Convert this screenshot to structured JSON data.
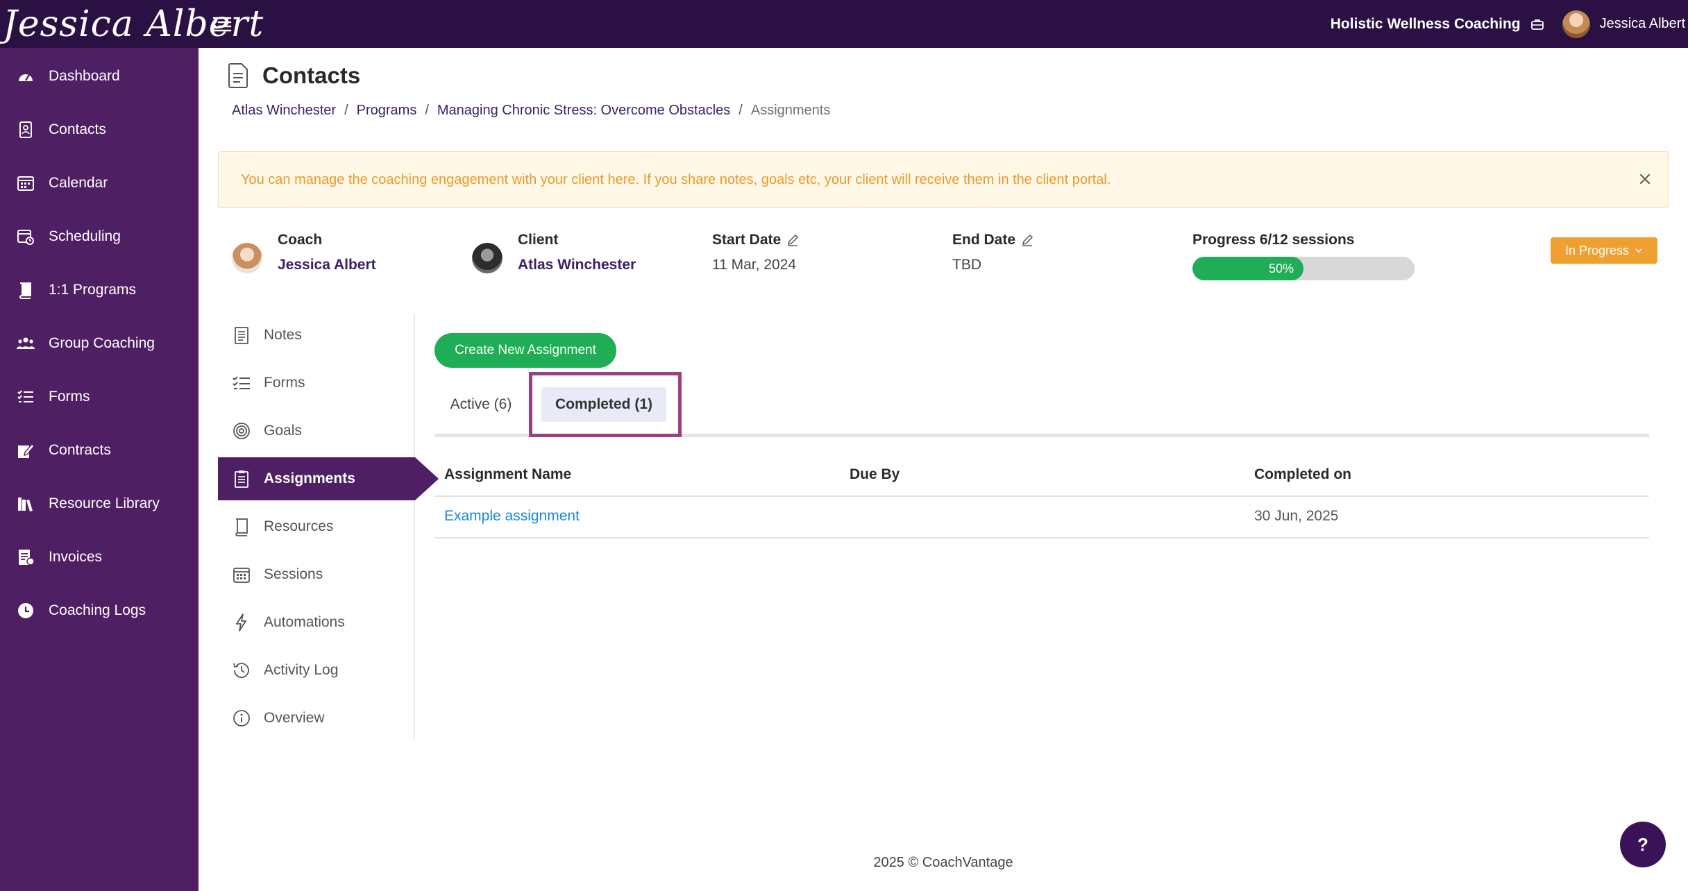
{
  "topbar": {
    "logo_text": "Jessica Albert",
    "business_name": "Holistic Wellness Coaching",
    "user_name": "Jessica Albert"
  },
  "sidebar": {
    "items": [
      {
        "label": "Dashboard",
        "icon": "dashboard-icon"
      },
      {
        "label": "Contacts",
        "icon": "contacts-icon"
      },
      {
        "label": "Calendar",
        "icon": "calendar-icon"
      },
      {
        "label": "Scheduling",
        "icon": "scheduling-icon"
      },
      {
        "label": "1:1 Programs",
        "icon": "book-icon"
      },
      {
        "label": "Group Coaching",
        "icon": "group-icon"
      },
      {
        "label": "Forms",
        "icon": "forms-icon"
      },
      {
        "label": "Contracts",
        "icon": "contract-icon"
      },
      {
        "label": "Resource Library",
        "icon": "library-icon"
      },
      {
        "label": "Invoices",
        "icon": "invoice-icon"
      },
      {
        "label": "Coaching Logs",
        "icon": "clock-icon"
      }
    ]
  },
  "page": {
    "title": "Contacts",
    "breadcrumb": [
      "Atlas Winchester",
      "Programs",
      "Managing Chronic Stress: Overcome Obstacles",
      "Assignments"
    ],
    "breadcrumb_sep": "/"
  },
  "alert": {
    "text": "You can manage the coaching engagement with your client here. If you share notes, goals etc, your client will receive them in the client portal."
  },
  "engagement": {
    "coach_label": "Coach",
    "coach_name": "Jessica Albert",
    "client_label": "Client",
    "client_name": "Atlas Winchester",
    "start_label": "Start Date",
    "start_value": "11 Mar, 2024",
    "end_label": "End Date",
    "end_value": "TBD",
    "progress_label": "Progress 6/12 sessions",
    "progress_percent": 50,
    "progress_text": "50%",
    "status": "In Progress"
  },
  "subnav": {
    "items": [
      {
        "label": "Notes"
      },
      {
        "label": "Forms"
      },
      {
        "label": "Goals"
      },
      {
        "label": "Assignments"
      },
      {
        "label": "Resources"
      },
      {
        "label": "Sessions"
      },
      {
        "label": "Automations"
      },
      {
        "label": "Activity Log"
      },
      {
        "label": "Overview"
      }
    ],
    "active": "Assignments"
  },
  "assignments": {
    "create_label": "Create New Assignment",
    "tabs": [
      {
        "label": "Active (6)"
      },
      {
        "label": "Completed (1)"
      }
    ],
    "columns": [
      "Assignment Name",
      "Due By",
      "Completed on"
    ],
    "rows": [
      {
        "name": "Example assignment",
        "due_by": "",
        "completed_on": "30 Jun, 2025"
      }
    ]
  },
  "footer": {
    "text": "2025 © CoachVantage"
  },
  "help": {
    "label": "?"
  },
  "colors": {
    "topbar": "#2b1143",
    "sidebar": "#4f1f63",
    "accent_green": "#1fad55",
    "status_orange": "#f0a030",
    "link_blue": "#1c86d6",
    "highlight": "#9b3f87"
  }
}
